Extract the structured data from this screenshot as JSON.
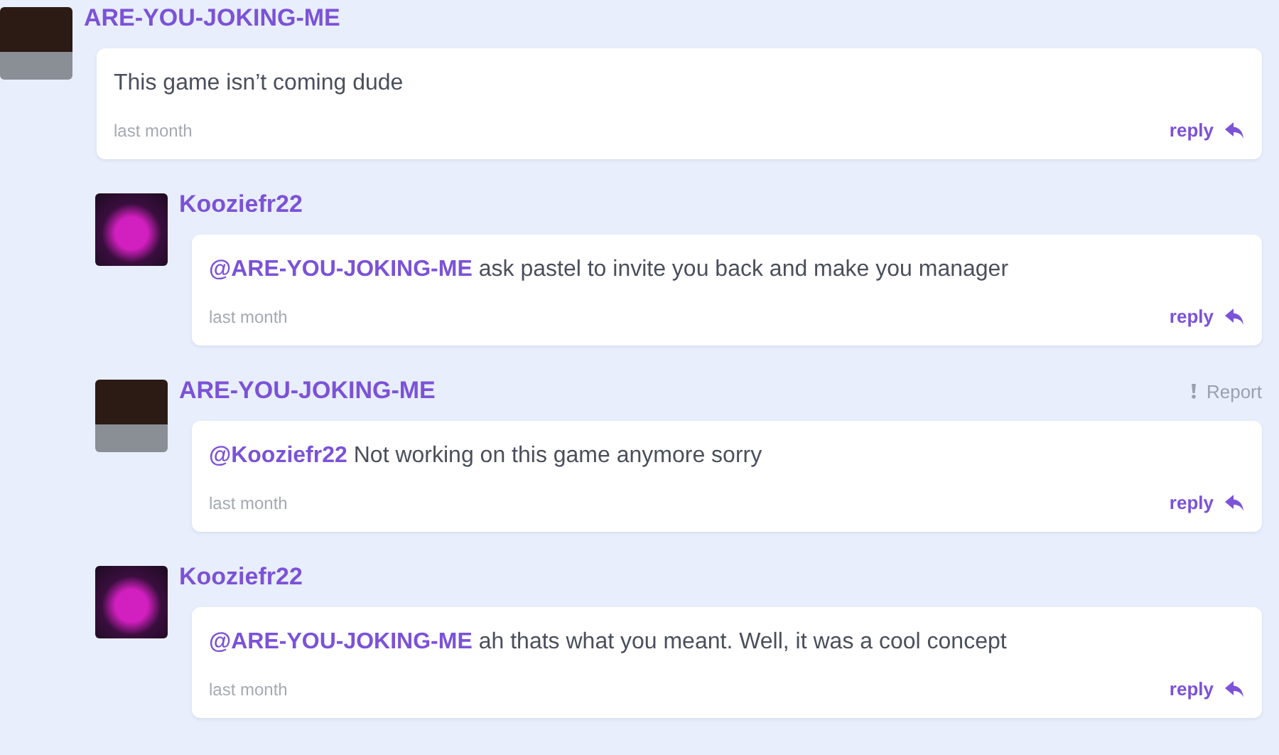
{
  "comments": [
    {
      "author": "ARE-YOU-JOKING-ME",
      "kind": "skull",
      "text": "This game isn’t coming dude",
      "time": "last month",
      "reply": "reply",
      "children": [
        {
          "author": "Kooziefr22",
          "kind": "monster",
          "mention": "@ARE-YOU-JOKING-ME",
          "text": "ask pastel to invite you back and make you manager",
          "time": "last month",
          "reply": "reply"
        },
        {
          "author": "ARE-YOU-JOKING-ME",
          "kind": "skull",
          "report": "Report",
          "mention": "@Kooziefr22",
          "text": "Not working on this game anymore sorry",
          "time": "last month",
          "reply": "reply"
        },
        {
          "author": "Kooziefr22",
          "kind": "monster",
          "mention": "@ARE-YOU-JOKING-ME",
          "text": "ah thats what you meant. Well, it was a cool concept",
          "time": "last month",
          "reply": "reply"
        }
      ]
    }
  ]
}
